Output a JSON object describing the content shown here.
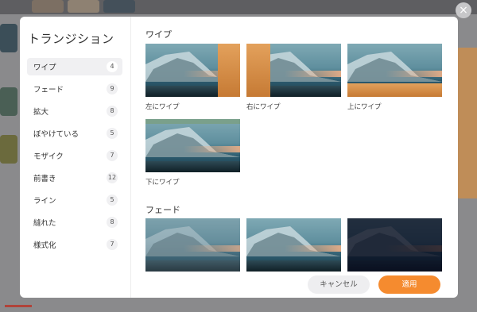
{
  "dialog": {
    "title": "トランジション",
    "categories": [
      {
        "label": "ワイプ",
        "count": "4"
      },
      {
        "label": "フェード",
        "count": "9"
      },
      {
        "label": "拡大",
        "count": "8"
      },
      {
        "label": "ぼやけている",
        "count": "5"
      },
      {
        "label": "モザイク",
        "count": "7"
      },
      {
        "label": "前書き",
        "count": "12"
      },
      {
        "label": "ライン",
        "count": "5"
      },
      {
        "label": "縫れた",
        "count": "8"
      },
      {
        "label": "様式化",
        "count": "7"
      }
    ],
    "sections": [
      {
        "title": "ワイプ",
        "items": [
          {
            "label": "左にワイプ"
          },
          {
            "label": "右にワイプ"
          },
          {
            "label": "上にワイプ"
          },
          {
            "label": "下にワイプ"
          }
        ]
      },
      {
        "title": "フェード",
        "items": [
          {
            "label": ""
          },
          {
            "label": ""
          },
          {
            "label": ""
          }
        ]
      }
    ],
    "buttons": {
      "cancel": "キャンセル",
      "apply": "適用"
    },
    "close_glyph": "×"
  },
  "colors": {
    "accent": "#f58b2f",
    "overlay": "#6d6d6f",
    "active_category": "#f0f0f2"
  }
}
